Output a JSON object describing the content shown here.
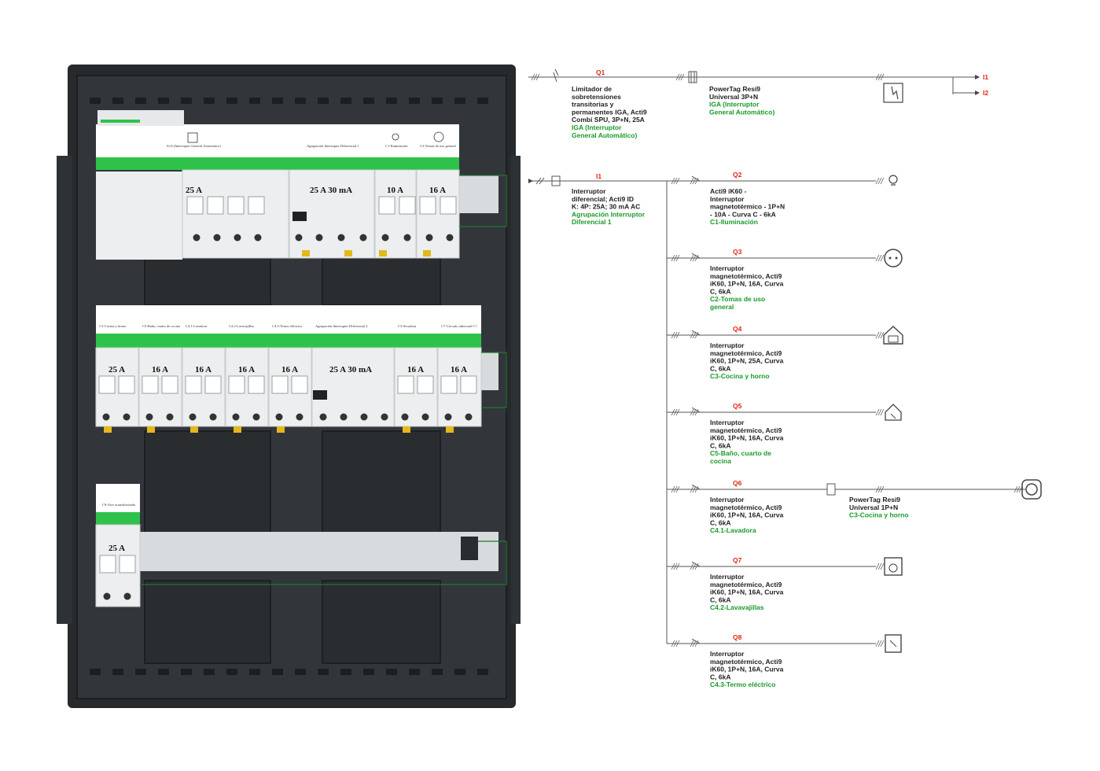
{
  "panel": {
    "row1": {
      "labels": [
        "IGA (Interruptor General Automático)",
        "Agrupación Interruptor Diferencial 1",
        "C1-Iluminación",
        "C2-Tomas de uso general"
      ],
      "ratings": [
        "25 A",
        "25 A 30 mA",
        "10 A",
        "16 A"
      ]
    },
    "row2": {
      "labels": [
        "C3-Cocina y horno",
        "C5-Baño, cuarto de cocina",
        "C4.1-Lavadora",
        "C4.2-Lavavajillas",
        "C4.3-Termo eléctrico",
        "Agrupación Interruptor Diferencial 2",
        "C3-Secadora",
        "C7-Circuito adicional C7"
      ],
      "ratings": [
        "25 A",
        "16 A",
        "16 A",
        "16 A",
        "16 A",
        "25 A 30 mA",
        "16 A",
        "16 A"
      ]
    },
    "row3": {
      "labels": [
        "C9-Aire acondicionado"
      ],
      "ratings": [
        "25 A"
      ]
    }
  },
  "schematic": {
    "top": {
      "q1": {
        "id": "Q1",
        "lines": [
          "Limitador de",
          "sobretensiones",
          "transitorias y",
          "permanentes IGA, Acti9",
          "Combi SPU, 3P+N, 25A"
        ],
        "green": [
          "IGA (Interruptor",
          "General Automático)"
        ]
      },
      "powertag": {
        "lines": [
          "PowerTag Resi9",
          "Universal 3P+N"
        ],
        "green": [
          "IGA (Interruptor",
          "General Automático)"
        ]
      },
      "outputs": [
        "I1",
        "I2"
      ]
    },
    "diff": {
      "id": "I1",
      "lines": [
        "Interruptor",
        "diferencial; Acti9 ID",
        "K: 4P: 25A; 30 mA AC"
      ],
      "green": [
        "Agrupación Interruptor",
        "Diferencial 1"
      ]
    },
    "circuits": [
      {
        "id": "Q2",
        "lines": [
          "Acti9 iK60 -",
          "Interruptor",
          "magnetotérmico - 1P+N",
          "- 10A - Curva C - 6kA"
        ],
        "green": [
          "C1-Iluminación"
        ],
        "icon": "lamp-icon"
      },
      {
        "id": "Q3",
        "lines": [
          "Interruptor",
          "magnetotérmico, Acti9",
          "iK60, 1P+N, 16A, Curva",
          "C, 6kA"
        ],
        "green": [
          "C2-Tomas de uso",
          "general"
        ],
        "icon": "socket-icon"
      },
      {
        "id": "Q4",
        "lines": [
          "Interruptor",
          "magnetotérmico, Acti9",
          "iK60, 1P+N, 25A, Curva",
          "C, 6kA"
        ],
        "green": [
          "C3-Cocina y horno"
        ],
        "icon": "oven-icon"
      },
      {
        "id": "Q5",
        "lines": [
          "Interruptor",
          "magnetotérmico, Acti9",
          "iK60, 1P+N, 16A, Curva",
          "C, 6kA"
        ],
        "green": [
          "C5-Baño, cuarto de",
          "cocina"
        ],
        "icon": "bathroom-icon"
      },
      {
        "id": "Q6",
        "lines": [
          "Interruptor",
          "magnetotérmico, Acti9",
          "iK60, 1P+N, 16A, Curva",
          "C, 6kA"
        ],
        "green": [
          "C4.1-Lavadora"
        ],
        "icon": "washer-icon",
        "powertag": {
          "lines": [
            "PowerTag Resi9",
            "Universal 1P+N"
          ],
          "green": [
            "C3-Cocina y horno"
          ]
        }
      },
      {
        "id": "Q7",
        "lines": [
          "Interruptor",
          "magnetotérmico, Acti9",
          "iK60, 1P+N, 16A, Curva",
          "C, 6kA"
        ],
        "green": [
          "C4.2-Lavavajillas"
        ],
        "icon": "dishwasher-icon"
      },
      {
        "id": "Q8",
        "lines": [
          "Interruptor",
          "magnetotérmico, Acti9",
          "iK60, 1P+N, 16A, Curva",
          "C, 6kA"
        ],
        "green": [
          "C4.3-Termo eléctrico"
        ],
        "icon": "water-heater-icon"
      }
    ]
  }
}
